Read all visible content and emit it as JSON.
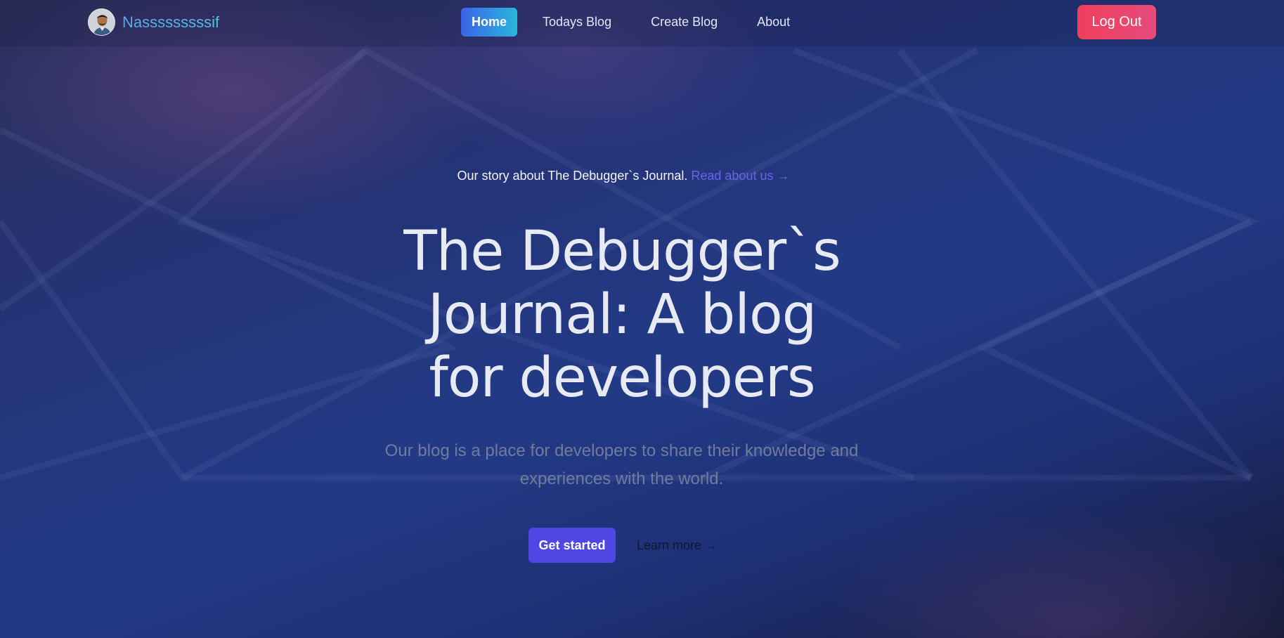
{
  "nav": {
    "brand_name": "Nasssssssssif",
    "links": [
      {
        "label": "Home",
        "active": true
      },
      {
        "label": "Todays Blog",
        "active": false
      },
      {
        "label": "Create Blog",
        "active": false
      },
      {
        "label": "About",
        "active": false
      }
    ],
    "logout_label": "Log Out"
  },
  "hero": {
    "story_text": "Our story about The Debugger`s Journal.",
    "story_link": "Read about us →",
    "headline_lines": [
      "The Debugger`s",
      "Journal: A blog",
      "for developers"
    ],
    "subtitle": "Our blog is a place for developers to share their knowledge and experiences with the world.",
    "primary_button": "Get started",
    "secondary_link": "Learn more →"
  },
  "colors": {
    "active_nav_gradient": [
      "#3a63e6",
      "#2ab7dc"
    ],
    "logout_gradient": [
      "#ef3f5b",
      "#e64a7d"
    ],
    "primary_button": "#5046e4",
    "story_link": "#6a63ee"
  },
  "icons": {
    "avatar": "user-photo-avatar"
  }
}
